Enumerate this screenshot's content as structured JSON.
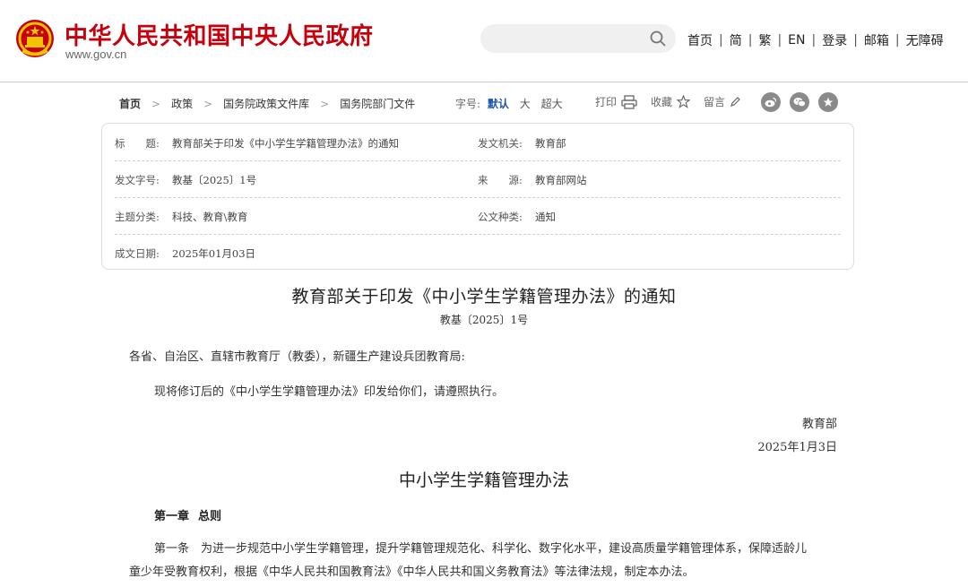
{
  "header": {
    "site_title": "中华人民共和国中央人民政府",
    "site_url": "www.gov.cn",
    "search": {
      "value": "",
      "placeholder": ""
    },
    "nav": [
      "首页",
      "简",
      "繁",
      "EN",
      "登录",
      "邮箱",
      "无障碍"
    ],
    "colors": {
      "brand": "#c7000b",
      "link": "#1a56a8"
    }
  },
  "breadcrumb": [
    "首页",
    "政策",
    "国务院政策文件库",
    "国务院部门文件"
  ],
  "font_size": {
    "label": "字号:",
    "options": [
      "默认",
      "大",
      "超大"
    ],
    "selected": "默认"
  },
  "tools": {
    "print": "打印",
    "favorite": "收藏",
    "comment": "留言"
  },
  "share_icons": [
    "weibo-icon",
    "wechat-icon",
    "star-icon"
  ],
  "meta": {
    "title_label": "标　　题:",
    "title_value": "教育部关于印发《中小学生学籍管理办法》的通知",
    "issuer_label": "发文机关:",
    "issuer_value": "教育部",
    "docno_label": "发文字号:",
    "docno_value": "教基〔2025〕1号",
    "source_label": "来　　源:",
    "source_value": "教育部网站",
    "topic_label": "主题分类:",
    "topic_value": "科技、教育\\教育",
    "type_label": "公文种类:",
    "type_value": "通知",
    "date_label": "成文日期:",
    "date_value": "2025年01月03日"
  },
  "document": {
    "title": "教育部关于印发《中小学生学籍管理办法》的通知",
    "number": "教基〔2025〕1号",
    "salutation": "各省、自治区、直辖市教育厅（教委），新疆生产建设兵团教育局:",
    "body": "现将修订后的《中小学生学籍管理办法》印发给你们，请遵照执行。",
    "signer": "教育部",
    "date": "2025年1月3日",
    "sub_title": "中小学生学籍管理办法",
    "chapter_num": "第一章",
    "chapter_name": "总则",
    "article_line1": "第一条　为进一步规范中小学生学籍管理，提升学籍管理规范化、科学化、数字化水平，建设高质量学籍管理体系，保障适龄儿",
    "article_line2": "童少年受教育权利，根据《中华人民共和国教育法》《中华人民共和国义务教育法》等法律法规，制定本办法。"
  }
}
